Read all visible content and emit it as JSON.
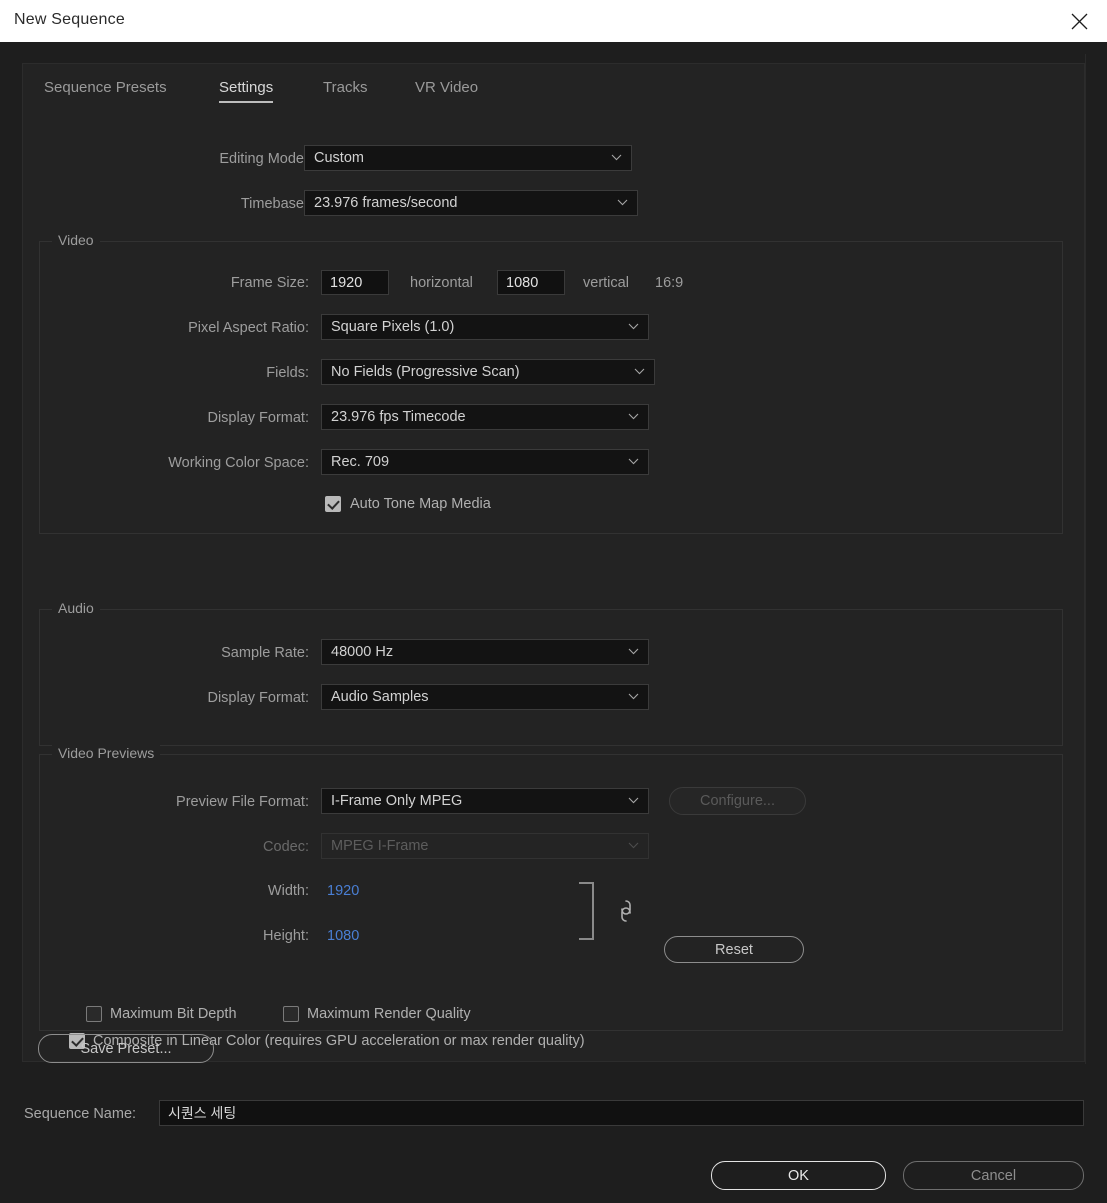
{
  "window": {
    "title": "New Sequence",
    "close_icon": "close-icon"
  },
  "tabs": [
    {
      "label": "Sequence Presets",
      "active": false
    },
    {
      "label": "Settings",
      "active": true
    },
    {
      "label": "Tracks",
      "active": false
    },
    {
      "label": "VR Video",
      "active": false
    }
  ],
  "general": {
    "editing_mode_label": "Editing Mode:",
    "editing_mode_value": "Custom",
    "timebase_label": "Timebase:",
    "timebase_value": "23.976  frames/second"
  },
  "video": {
    "legend": "Video",
    "frame_size_label": "Frame Size:",
    "frame_width": "1920",
    "horizontal_label": "horizontal",
    "frame_height": "1080",
    "vertical_label": "vertical",
    "aspect_ratio": "16:9",
    "pixel_aspect_label": "Pixel Aspect Ratio:",
    "pixel_aspect_value": "Square Pixels (1.0)",
    "fields_label": "Fields:",
    "fields_value": "No Fields (Progressive Scan)",
    "display_format_label": "Display Format:",
    "display_format_value": "23.976 fps Timecode",
    "working_color_space_label": "Working Color Space:",
    "working_color_space_value": "Rec. 709",
    "auto_tone_map_label": "Auto Tone Map Media",
    "auto_tone_map_checked": true
  },
  "audio": {
    "legend": "Audio",
    "sample_rate_label": "Sample Rate:",
    "sample_rate_value": "48000 Hz",
    "display_format_label": "Display Format:",
    "display_format_value": "Audio Samples"
  },
  "video_previews": {
    "legend": "Video Previews",
    "preview_file_format_label": "Preview File Format:",
    "preview_file_format_value": "I-Frame Only MPEG",
    "configure_label": "Configure...",
    "configure_disabled": true,
    "codec_label": "Codec:",
    "codec_value": "MPEG I-Frame",
    "codec_disabled": true,
    "width_label": "Width:",
    "width_value": "1920",
    "height_label": "Height:",
    "height_value": "1080",
    "link_icon": "chain-link-icon",
    "bracket_icon": "bracket-icon",
    "reset_label": "Reset",
    "max_bit_depth_label": "Maximum Bit Depth",
    "max_bit_depth_checked": false,
    "max_render_quality_label": "Maximum Render Quality",
    "max_render_quality_checked": false,
    "composite_linear_label": "Composite in Linear Color (requires GPU acceleration or max render quality)",
    "composite_linear_checked": true
  },
  "footer": {
    "save_preset_label": "Save Preset...",
    "sequence_name_label": "Sequence Name:",
    "sequence_name_value": "시퀀스 세팅",
    "ok_label": "OK",
    "cancel_label": "Cancel"
  },
  "colors": {
    "background": "#1e1e1e",
    "panel": "#232323",
    "titlebar": "#ffffff",
    "accent_blue": "#4a7fd4",
    "text": "#b4b4b4"
  }
}
